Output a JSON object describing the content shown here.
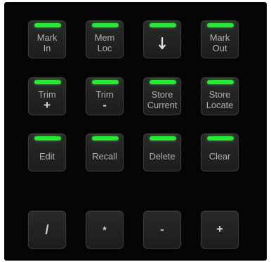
{
  "keypad": {
    "row1": {
      "mark_in": {
        "line1": "Mark",
        "line2": "In"
      },
      "mem_loc": {
        "line1": "Mem",
        "line2": "Loc"
      },
      "down": {
        "icon": "arrow-down-icon"
      },
      "mark_out": {
        "line1": "Mark",
        "line2": "Out"
      }
    },
    "row2": {
      "trim_plus": {
        "line1": "Trim",
        "line2": "+"
      },
      "trim_minus": {
        "line1": "Trim",
        "line2": "-"
      },
      "store_current": {
        "line1": "Store",
        "line2": "Current"
      },
      "store_locate": {
        "line1": "Store",
        "line2": "Locate"
      }
    },
    "row3": {
      "edit": "Edit",
      "recall": "Recall",
      "delete": "Delete",
      "clear": "Clear"
    },
    "row4": {
      "slash": "/",
      "asterisk": "*",
      "minus": "-",
      "plus": "+"
    }
  },
  "colors": {
    "led_on": "#27ea33",
    "key_face": "#242424",
    "label": "#b0b0b0",
    "panel": "#050505"
  }
}
